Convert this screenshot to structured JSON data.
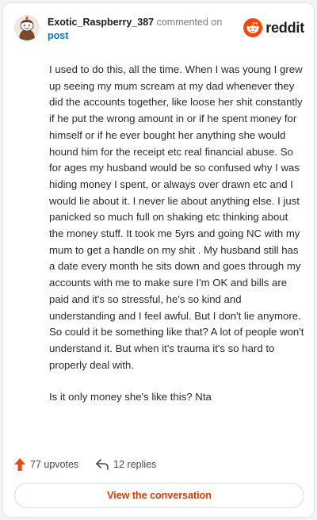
{
  "header": {
    "username": "Exotic_Raspberry_387",
    "commented_on": "commented on",
    "post_link": "post",
    "logo_text": "reddit"
  },
  "comment": {
    "paragraphs": [
      "I used to do this, all the time. When I was young I grew up seeing my mum scream at my dad whenever they did the accounts together, like loose her shit constantly if he put the wrong amount in or if he spent money for himself or if he ever bought her anything she would hound him for the receipt etc real financial abuse. So for ages my husband would be so confused why I was hiding money I spent, or always over drawn etc and I would lie about it. I never lie about anything else. I just panicked so much full on shaking etc thinking about the money stuff. It took me 5yrs and going NC with my mum to get a handle on my shit . My husband still has a date every month he sits down and goes through my accounts with me to make sure I'm OK and bills are paid and it's so stressful, he's so kind and understanding and I feel awful. But I don't lie anymore. So could it be something like that? A lot of people won't understand it. But when it's trauma it's so hard to properly deal with.",
      "Is it only money she's like this? Nta"
    ]
  },
  "actions": {
    "upvotes": "77 upvotes",
    "replies": "12 replies",
    "view_conversation": "View the conversation"
  },
  "icons": {
    "avatar": "snoo-avatar-icon",
    "logo": "reddit-snoo-icon",
    "upvote": "upvote-arrow-icon",
    "reply": "reply-arrow-icon"
  },
  "colors": {
    "brand_orange": "#ff4500",
    "link_blue": "#0079d3",
    "button_text": "#d93a00"
  }
}
